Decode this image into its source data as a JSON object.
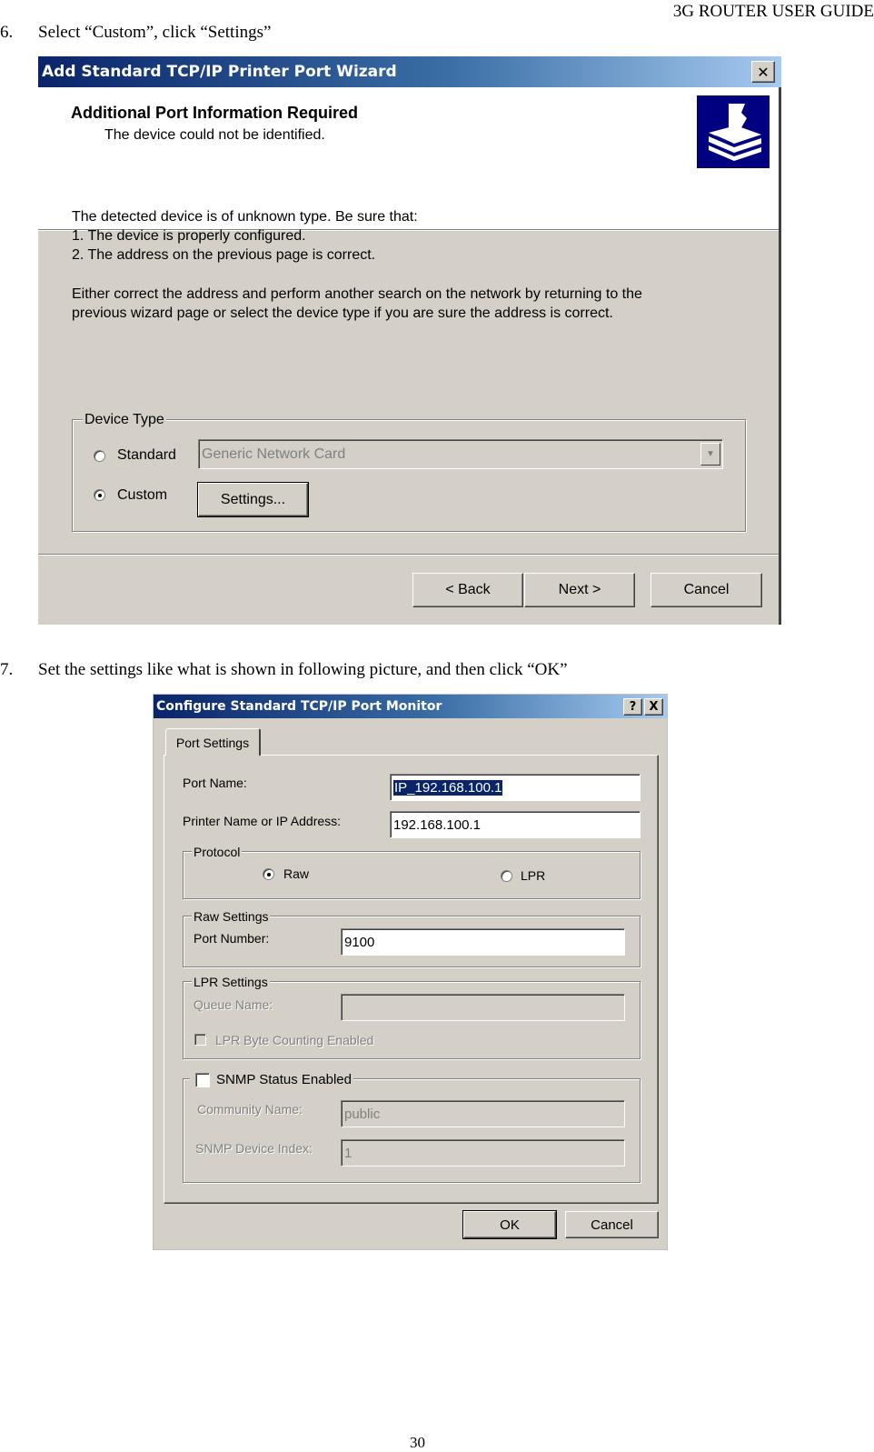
{
  "document": {
    "header": "3G ROUTER USER GUIDE",
    "page_number": "30",
    "steps": [
      {
        "number": "6.",
        "text": "Select “Custom”, click “Settings”"
      },
      {
        "number": "7.",
        "text": "Set the settings like what is shown in following picture, and then click “OK”"
      }
    ]
  },
  "wizard": {
    "title": "Add Standard TCP/IP Printer Port Wizard",
    "close_icon": "close-icon",
    "header_title": "Additional Port Information Required",
    "header_subtitle": "The device could not be identified.",
    "printer_icon": "printer-icon",
    "body_lines": [
      "The detected device is of unknown type.  Be sure that:",
      "1. The device is properly configured.",
      "2.  The address on the previous page is correct."
    ],
    "body_paragraph": [
      "Either correct the address and perform another search on the network by returning to the",
      "previous wizard page or select the device type if you are sure the address is correct."
    ],
    "device_type": {
      "label": "Device Type",
      "standard_label": "Standard",
      "standard_checked": false,
      "standard_select_value": "Generic Network Card",
      "custom_label": "Custom",
      "custom_checked": true,
      "settings_button": "Settings..."
    },
    "buttons": {
      "back": "< Back",
      "next": "Next >",
      "cancel": "Cancel"
    }
  },
  "port_monitor": {
    "title": "Configure Standard TCP/IP Port Monitor",
    "help_button": "?",
    "close_button": "X",
    "tab_label": "Port Settings",
    "port_name_label": "Port Name:",
    "port_name_value": "IP_192.168.100.1",
    "printer_address_label": "Printer Name or IP Address:",
    "printer_address_value": "192.168.100.1",
    "protocol": {
      "label": "Protocol",
      "raw_label": "Raw",
      "raw_checked": true,
      "lpr_label": "LPR",
      "lpr_checked": false
    },
    "raw_settings": {
      "label": "Raw Settings",
      "port_number_label": "Port Number:",
      "port_number_value": "9100"
    },
    "lpr_settings": {
      "label": "LPR Settings",
      "queue_name_label": "Queue Name:",
      "queue_name_value": "",
      "byte_counting_label": "LPR Byte Counting Enabled",
      "byte_counting_checked": false
    },
    "snmp": {
      "label": "SNMP Status Enabled",
      "checked": false,
      "community_label": "Community Name:",
      "community_value": "public",
      "device_index_label": "SNMP Device Index:",
      "device_index_value": "1"
    },
    "buttons": {
      "ok": "OK",
      "cancel": "Cancel"
    }
  }
}
